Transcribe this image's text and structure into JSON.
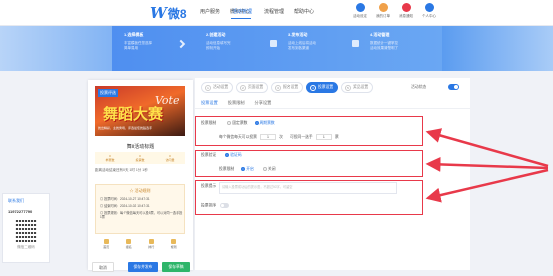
{
  "brand": {
    "logo_glyph": "W",
    "logo_text": "微8"
  },
  "nav": {
    "items": [
      "用户服务",
      "微积中心",
      "活动管理",
      "流程管理",
      "帮助中心"
    ],
    "active_index": 2
  },
  "top_tools": [
    {
      "label": "活动设定",
      "color": "#2a78e4"
    },
    {
      "label": "我的订单",
      "color": "#f0a14a"
    },
    {
      "label": "消息通知",
      "color": "#e8394a"
    },
    {
      "label": "个人中心",
      "color": "#2a78e4"
    }
  ],
  "steps": [
    {
      "title": "1.选择模板",
      "desc1": "丰富模板任您选择",
      "desc2": "简单易用"
    },
    {
      "title": "2.创建活动",
      "desc1": "活动信息填写完",
      "desc2": "即刻开始"
    },
    {
      "title": "3.发布活动",
      "desc1": "活动上线后将活动",
      "desc2": "发布到各渠道"
    },
    {
      "title": "4.活动管理",
      "desc1": "数据统计一键掌控",
      "desc2": "活动效果清楚明了"
    }
  ],
  "contact": {
    "line1": "联系我们",
    "phone": "11972277790",
    "qr_caption": "微信二维码"
  },
  "preview": {
    "poster_tag": "投票评选",
    "poster_title": "舞蹈大赛",
    "poster_deco": "Vote",
    "poster_sub": "舞出精彩，主舞秀场，评选最佳舞蹈选手",
    "title": "舞Ⅱ活动标题",
    "stats": [
      {
        "label": "参赛数",
        "value": "0"
      },
      {
        "label": "投票数",
        "value": "0"
      },
      {
        "label": "访问量",
        "value": "0"
      }
    ],
    "fav": "距离活动结束还有0天 1时 1分 1秒",
    "card_title": "☆ 活动规则",
    "card_rows": [
      "◎ 投票时间：2024-10-27 10:47:31",
      "◎ 结束时间：2024-10-02 10:47:31",
      "◎ 投票规则：每个微信每天可以投5票，可以对同一选手投1票"
    ],
    "tabs": [
      "首页",
      "报名",
      "排行",
      "规则"
    ],
    "buttons": {
      "back": "取消",
      "save": "保存并发布",
      "publish": "保存草稿"
    }
  },
  "editor": {
    "steps": [
      {
        "num": "1",
        "label": "活动设置"
      },
      {
        "num": "2",
        "label": "页面设置"
      },
      {
        "num": "3",
        "label": "报名设置"
      },
      {
        "num": "4",
        "label": "投票设置"
      },
      {
        "num": "5",
        "label": "奖品设置"
      }
    ],
    "active_step_index": 3,
    "toggle_label": "活动状态",
    "subtabs": [
      "投票设置",
      "投票限制",
      "分享设置"
    ],
    "active_subtab_index": 0,
    "vote_limit": {
      "label": "投票限制",
      "opt_a": "固定票数",
      "opt_b": "周期票数",
      "per_label": "每个微信每天可以投票",
      "per_value": "1",
      "per_unit": "次",
      "same_label": "可投同一选手",
      "same_value": "1",
      "same_unit": "票"
    },
    "verify": {
      "label": "投票验证",
      "opt": "验证码",
      "sub_label": "投票限制",
      "opt_on": "开启",
      "opt_off": "关闭"
    },
    "tip": {
      "label": "投票提示",
      "placeholder": "请输入投票成功后的提示语，不超过50字，可留空"
    },
    "switch_label": "投票排序"
  }
}
